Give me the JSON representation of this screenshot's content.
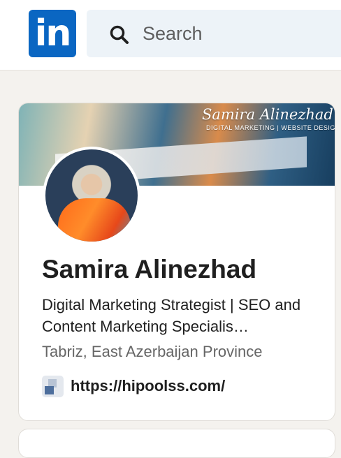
{
  "header": {
    "logo_text": "in",
    "search_placeholder": "Search",
    "brand_color": "#0a66c2"
  },
  "profile": {
    "banner_title": "Samira Alinezhad",
    "banner_subtitle": "DIGITAL MARKETING | WEBSITE DESIGN",
    "name": "Samira Alinezhad",
    "headline": "Digital Marketing Strategist | SEO and Content Marketing Specialis…",
    "location": "Tabriz, East Azerbaijan Province",
    "website": "https://hipoolss.com/"
  },
  "icons": {
    "search": "search-icon",
    "website": "website-favicon-icon"
  }
}
